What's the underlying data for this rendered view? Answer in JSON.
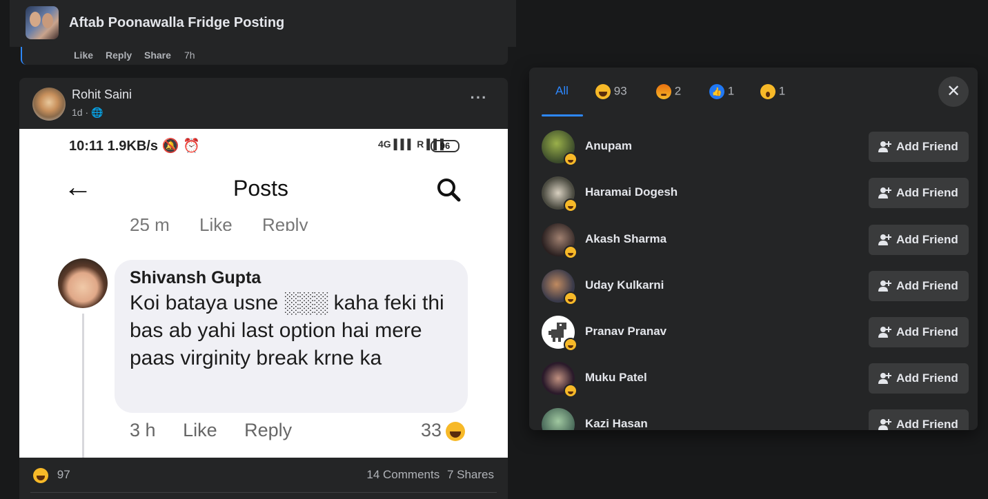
{
  "top_comment": {
    "title": "Aftab Poonawalla Fridge Posting",
    "actions": {
      "like": "Like",
      "reply": "Reply",
      "share": "Share",
      "time": "7h"
    }
  },
  "post": {
    "author": "Rohit Saini",
    "meta": "1d · 🌐",
    "more": "···",
    "screenshot": {
      "status_time": "10:11  1.9KB/s 🔕 ⏰",
      "status_icons": "4G ▌▌▌  R ▌▌▌",
      "battery": "96",
      "back": "←",
      "title": "Posts",
      "cut_time": "25 m",
      "cut_like": "Like",
      "cut_reply": "Reply",
      "comment": {
        "name": "Shivansh Gupta",
        "text": "Koi bataya usne ░░░ kaha feki thi bas ab yahi last option hai mere paas virginity break krne ka",
        "time": "3 h",
        "like": "Like",
        "reply": "Reply",
        "reactions": "33"
      }
    },
    "footer": {
      "reactions": "97",
      "comments": "14 Comments",
      "shares": "7 Shares"
    }
  },
  "reactions_dialog": {
    "tabs": [
      {
        "label": "All"
      },
      {
        "label": "93",
        "icon": "haha-icon"
      },
      {
        "label": "2",
        "icon": "angry-icon"
      },
      {
        "label": "1",
        "icon": "like-icon"
      },
      {
        "label": "1",
        "icon": "wow-icon"
      }
    ],
    "close": "✕",
    "add_friend_label": "Add Friend",
    "people": [
      {
        "name": "Anupam"
      },
      {
        "name": "Haramai Dogesh"
      },
      {
        "name": "Akash Sharma"
      },
      {
        "name": "Uday Kulkarni"
      },
      {
        "name": "Pranav Pranav"
      },
      {
        "name": "Muku Patel"
      },
      {
        "name": "Kazi Hasan"
      }
    ]
  },
  "colors": {
    "accent": "#2d88ff",
    "card": "#242526",
    "background": "#18191a",
    "haha": "#f7b928"
  }
}
